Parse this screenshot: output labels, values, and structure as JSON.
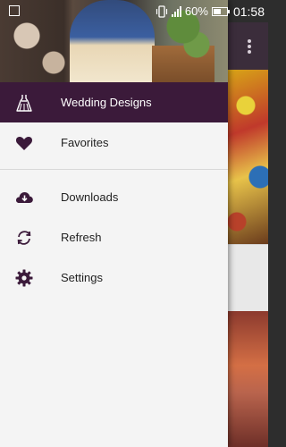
{
  "status_bar": {
    "battery_text": "60%",
    "battery_level": 0.6,
    "time": "01:58",
    "icons": [
      "image-notification-icon",
      "vibrate-icon",
      "signal-icon",
      "battery-icon"
    ]
  },
  "drawer": {
    "items": [
      {
        "label": "Wedding Designs",
        "icon": "dress-icon",
        "active": true
      },
      {
        "label": "Favorites",
        "icon": "heart-icon",
        "active": false
      },
      {
        "label": "Downloads",
        "icon": "cloud-download-icon",
        "active": false
      },
      {
        "label": "Refresh",
        "icon": "refresh-icon",
        "active": false
      },
      {
        "label": "Settings",
        "icon": "gear-icon",
        "active": false
      }
    ]
  },
  "colors": {
    "accent": "#3b1a3a",
    "icon": "#3b1a3a",
    "drawer_bg": "#f4f4f4"
  }
}
